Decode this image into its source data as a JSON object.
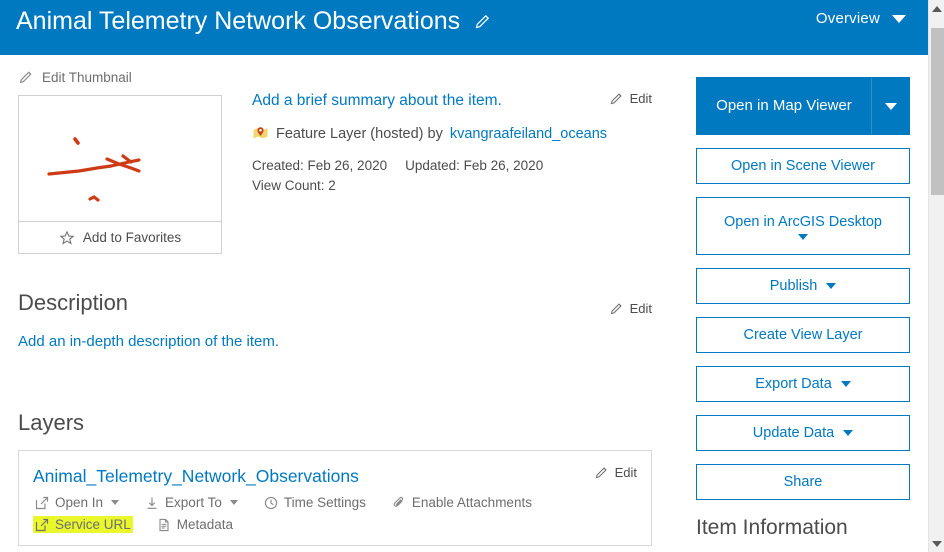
{
  "header": {
    "title": "Animal Telemetry Network Observations",
    "edit_title_icon": "pencil-icon",
    "view_selector_label": "Overview",
    "view_selector_icon": "caret-down-icon",
    "background_color": "#0079c1"
  },
  "thumbnail": {
    "edit_label": "Edit Thumbnail",
    "edit_icon": "pencil-icon",
    "favorite_label": "Add to Favorites",
    "favorite_icon": "star-outline-icon",
    "image_alt": "map thumbnail with red track lines"
  },
  "summary": {
    "placeholder_link": "Add a brief summary about the item.",
    "edit_label": "Edit",
    "edit_icon": "pencil-icon",
    "item_type_icon": "feature-layer-icon",
    "item_type": "Feature Layer (hosted) by",
    "owner": "kvangraafeiland_oceans",
    "created_label": "Created: Feb 26, 2020",
    "updated_label": "Updated: Feb 26, 2020",
    "view_count_label": "View Count: 2"
  },
  "description": {
    "title": "Description",
    "edit_label": "Edit",
    "edit_icon": "pencil-icon",
    "placeholder_link": "Add an in-depth description of the item."
  },
  "layers": {
    "title": "Layers",
    "edit_label": "Edit",
    "edit_icon": "pencil-icon",
    "layer_name": "Animal_Telemetry_Network_Observations",
    "actions": [
      {
        "label": "Open In",
        "icon": "external-link-icon",
        "has_caret": true,
        "highlighted": false
      },
      {
        "label": "Export To",
        "icon": "download-icon",
        "has_caret": true,
        "highlighted": false
      },
      {
        "label": "Time Settings",
        "icon": "clock-icon",
        "has_caret": false,
        "highlighted": false
      },
      {
        "label": "Enable Attachments",
        "icon": "paperclip-icon",
        "has_caret": false,
        "highlighted": false
      },
      {
        "label": "Service URL",
        "icon": "external-link-icon",
        "has_caret": false,
        "highlighted": true
      },
      {
        "label": "Metadata",
        "icon": "document-icon",
        "has_caret": false,
        "highlighted": false
      }
    ],
    "highlight_color": "#eaf72c"
  },
  "sidebar": {
    "primary_button": {
      "label": "Open in Map Viewer",
      "dropdown_icon": "caret-down-icon"
    },
    "buttons": [
      {
        "label": "Open in Scene Viewer",
        "has_caret": false,
        "caret_below": false
      },
      {
        "label": "Open in ArcGIS Desktop",
        "has_caret": false,
        "caret_below": true
      },
      {
        "label": "Publish",
        "has_caret": true,
        "caret_below": false
      },
      {
        "label": "Create View Layer",
        "has_caret": false,
        "caret_below": false
      },
      {
        "label": "Export Data",
        "has_caret": true,
        "caret_below": false
      },
      {
        "label": "Update Data",
        "has_caret": true,
        "caret_below": false
      },
      {
        "label": "Share",
        "has_caret": false,
        "caret_below": false
      }
    ],
    "item_information_title": "Item Information",
    "accent_color": "#0079c1"
  },
  "scrollbar": {
    "up_icon": "triangle-up-icon",
    "down_icon": "triangle-down-icon"
  }
}
